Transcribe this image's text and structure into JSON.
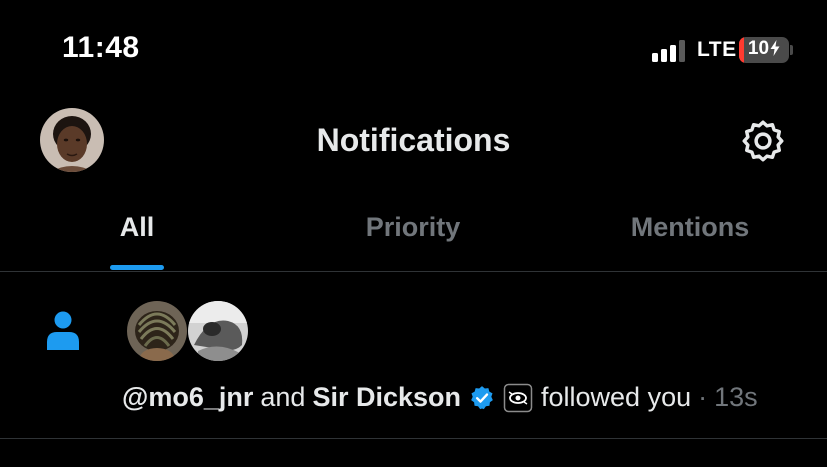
{
  "status_bar": {
    "time": "11:48",
    "network": "LTE",
    "battery_level": "10",
    "battery_percent": 10
  },
  "header": {
    "title": "Notifications"
  },
  "tabs": [
    {
      "label": "All",
      "active": true
    },
    {
      "label": "Priority",
      "active": false
    },
    {
      "label": "Mentions",
      "active": false
    }
  ],
  "notification": {
    "user1": "@mo6_jnr",
    "conjunction": "and",
    "user2": "Sir Dickson",
    "action": "followed you",
    "separator": "·",
    "time": "13s"
  },
  "icons": {
    "settings": "gear-icon",
    "notification_type": "person-icon",
    "verified": "verified-badge-icon",
    "affiliation": "affiliate-icon",
    "charging": "lightning-bolt-icon"
  },
  "colors": {
    "accent": "#1d9bf0",
    "background": "#000000",
    "text_primary": "#e7e9ea",
    "text_secondary": "#71767b",
    "battery_low": "#ff3b30",
    "divider": "#2f3336"
  }
}
